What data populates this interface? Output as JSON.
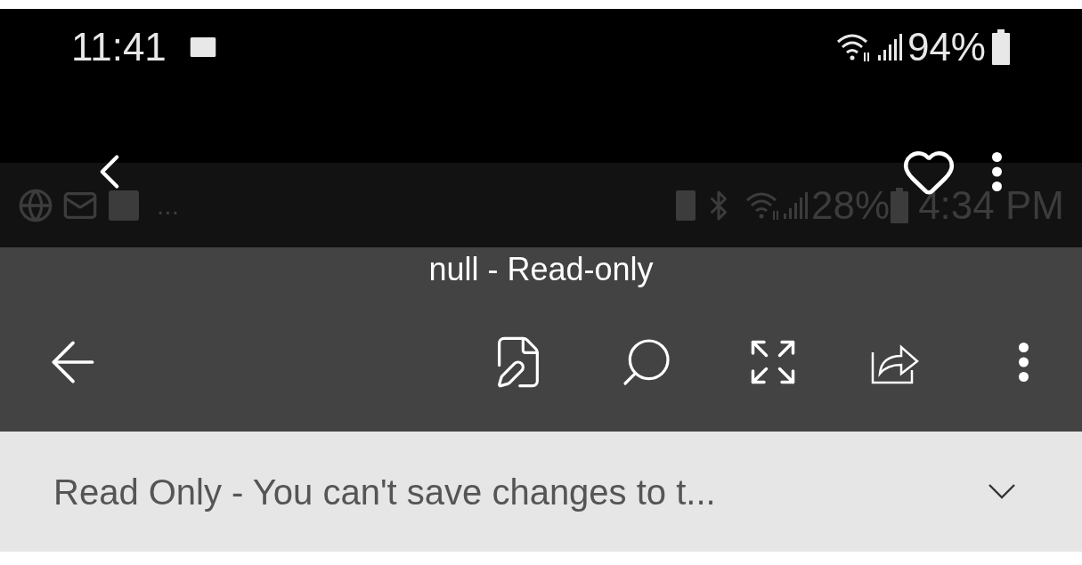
{
  "status_bar": {
    "time": "11:41",
    "battery": "94%"
  },
  "overlay_status_bar": {
    "more": "...",
    "battery": "28%",
    "time": "4:34 PM"
  },
  "document": {
    "title": "null - Read-only"
  },
  "banner": {
    "message": "Read Only - You can't save changes to t...",
    "expanded": false
  }
}
